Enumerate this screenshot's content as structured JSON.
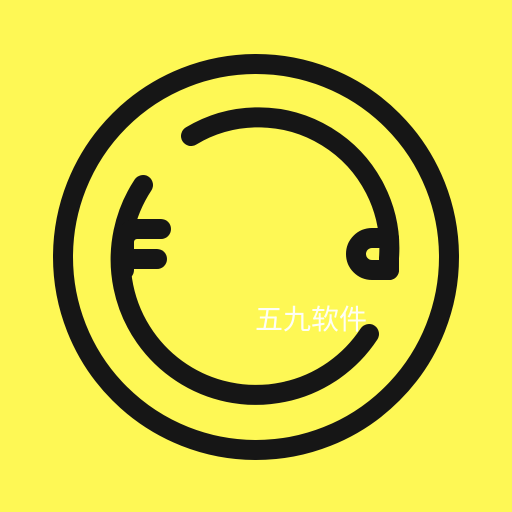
{
  "icon": {
    "name": "foodie-app-logo",
    "background_color": "#FEF855",
    "stroke_color": "#161616"
  },
  "watermark": {
    "text": "五九软件",
    "color": "#FFFFFF"
  }
}
